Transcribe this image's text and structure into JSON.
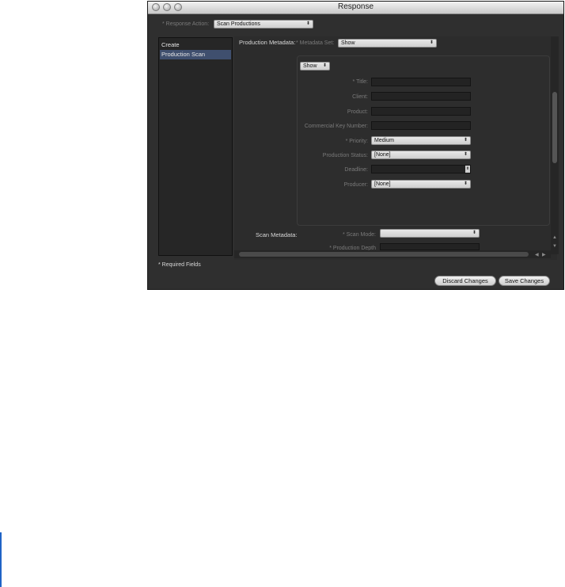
{
  "window": {
    "title": "Response"
  },
  "header": {
    "response_action_label": "* Response Action:",
    "response_action_value": "Scan Productions"
  },
  "sidebar": {
    "items": [
      {
        "label": "Create"
      },
      {
        "label": "Production Scan"
      }
    ]
  },
  "production_metadata": {
    "section_label": "Production Metadata:",
    "metadata_set_label": "* Metadata Set:",
    "metadata_set_value": "Show",
    "group_popup_value": "Show",
    "fields": {
      "title_label": "* Title:",
      "client_label": "Client:",
      "product_label": "Product:",
      "commercial_key_label": "Commercial Key Number:",
      "priority_label": "* Priority:",
      "priority_value": "Medium",
      "production_status_label": "Production Status:",
      "production_status_value": "[None]",
      "deadline_label": "Deadline:",
      "producer_label": "Producer:",
      "producer_value": "[None]"
    }
  },
  "scan_metadata": {
    "section_label": "Scan Metadata:",
    "scan_mode_label": "* Scan Mode:",
    "production_depth_label": "* Production Depth"
  },
  "footer": {
    "required_note": "* Required Fields",
    "discard_label": "Discard Changes",
    "save_label": "Save Changes"
  }
}
